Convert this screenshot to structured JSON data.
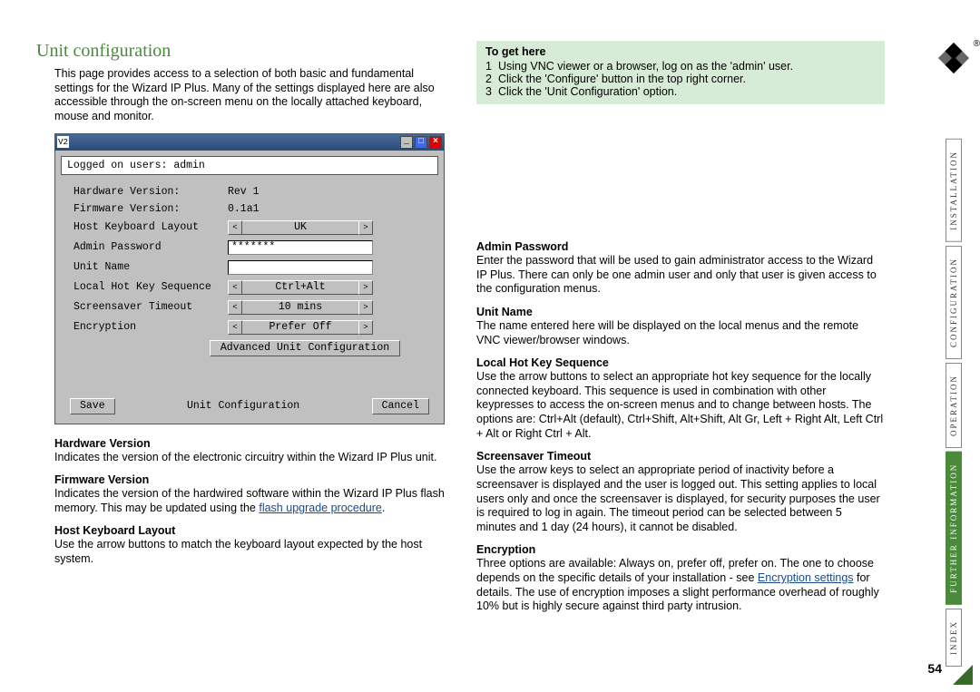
{
  "page": {
    "title": "Unit configuration",
    "intro": "This page provides access to a selection of both basic and fundamental settings for the Wizard IP Plus. Many of the settings displayed here are also accessible through the on-screen menu on the locally attached keyboard, mouse and monitor.",
    "number": "54"
  },
  "dialog": {
    "title_icon": "V2",
    "logged_on": "Logged on users: admin",
    "rows": {
      "hw_ver_label": "Hardware Version:",
      "hw_ver_value": "Rev 1",
      "fw_ver_label": "Firmware Version:",
      "fw_ver_value": "0.1a1",
      "host_kb_label": "Host Keyboard Layout",
      "host_kb_value": "UK",
      "admin_pw_label": "Admin Password",
      "admin_pw_value": "*******",
      "unit_name_label": "Unit Name",
      "unit_name_value": "",
      "hotkey_label": "Local Hot Key Sequence",
      "hotkey_value": "Ctrl+Alt",
      "ss_label": "Screensaver Timeout",
      "ss_value": "10 mins",
      "enc_label": "Encryption",
      "enc_value": "Prefer Off"
    },
    "adv_button": "Advanced Unit Configuration",
    "save_button": "Save",
    "footer_label": "Unit Configuration",
    "cancel_button": "Cancel"
  },
  "left_sections": {
    "hw": {
      "title": "Hardware Version",
      "body": "Indicates the version of the electronic circuitry within the Wizard IP Plus unit."
    },
    "fw": {
      "title": "Firmware Version",
      "body_a": "Indicates the version of the hardwired software within the Wizard IP Plus flash memory. This may be updated using the ",
      "link": "flash upgrade procedure",
      "body_b": "."
    },
    "hk": {
      "title": "Host Keyboard Layout",
      "body": "Use the arrow buttons to match the keyboard layout expected by the host system."
    }
  },
  "hint": {
    "title": "To get here",
    "s1": "Using VNC viewer or a browser, log on as the 'admin' user.",
    "s2": "Click the 'Configure' button in the top right corner.",
    "s3": "Click the 'Unit Configuration' option."
  },
  "right_sections": {
    "ap": {
      "title": "Admin Password",
      "body": "Enter the password that will be used to gain administrator access to the Wizard IP Plus. There can only be one admin user and only that user is given access to the configuration menus."
    },
    "un": {
      "title": "Unit Name",
      "body": "The name entered here will be displayed on the local menus and the remote VNC viewer/browser windows."
    },
    "lhk": {
      "title": "Local Hot Key Sequence",
      "body": "Use the arrow buttons to select an appropriate hot key sequence for the locally connected keyboard. This sequence is used in combination with other keypresses to access the on-screen menus and to change between hosts. The options are: Ctrl+Alt (default), Ctrl+Shift, Alt+Shift, Alt Gr, Left + Right Alt, Left Ctrl + Alt or Right Ctrl + Alt."
    },
    "st": {
      "title": "Screensaver Timeout",
      "body": "Use the arrow keys to select an appropriate period of inactivity before a screensaver is displayed and the user is logged out. This setting applies to local users only and once the screensaver is displayed, for security purposes the user is required to log in again. The timeout period can be selected between 5 minutes and 1 day (24 hours), it cannot be disabled."
    },
    "enc": {
      "title": "Encryption",
      "body_a": "Three options are available: Always on, prefer off, prefer on. The one to choose depends on the specific details of your installation - see ",
      "link": "Encryption settings",
      "body_b": " for details. The use of encryption imposes a slight performance overhead of roughly 10% but is highly secure against third party intrusion."
    }
  },
  "tabs": {
    "install": "INSTALLATION",
    "config": "CONFIGURATION",
    "oper": "OPERATION",
    "further1": "FURTHER",
    "further2": "INFORMATION",
    "index": "INDEX"
  }
}
